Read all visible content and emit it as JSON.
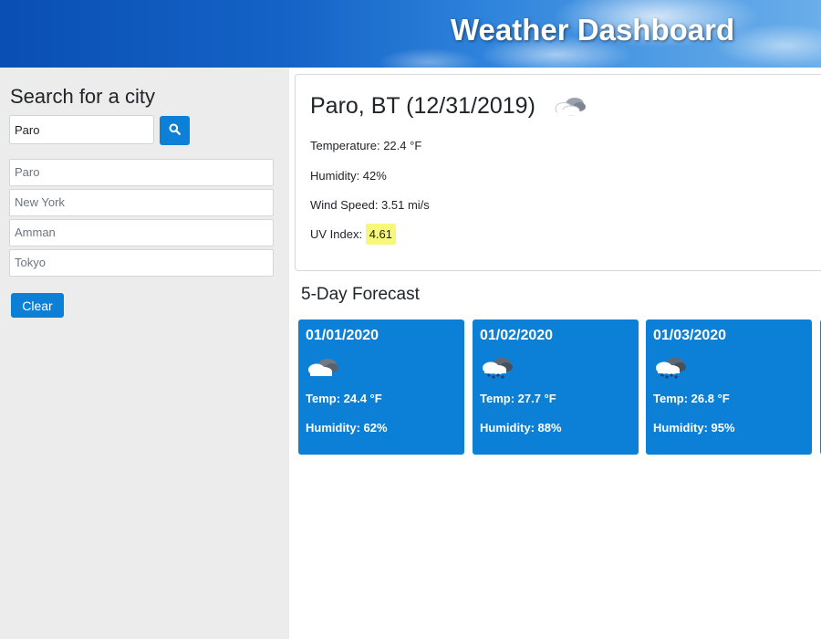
{
  "header": {
    "title": "Weather Dashboard"
  },
  "sidebar": {
    "title": "Search for a city",
    "search_value": "Paro",
    "search_icon": "search-icon",
    "history": [
      "Paro",
      "New York",
      "Amman",
      "Tokyo"
    ],
    "clear_label": "Clear"
  },
  "current": {
    "heading": "Paro, BT (12/31/2019)",
    "icon": "cloud-icon",
    "temperature": "Temperature: 22.4 °F",
    "humidity": "Humidity: 42%",
    "wind": "Wind Speed: 3.51 mi/s",
    "uv_label": "UV Index: ",
    "uv_value": "4.61"
  },
  "forecast": {
    "title": "5-Day Forecast",
    "days": [
      {
        "date": "01/01/2020",
        "icon": "cloud-icon",
        "temp": "Temp: 24.4 °F",
        "humidity": "Humidity: 62%"
      },
      {
        "date": "01/02/2020",
        "icon": "snow-cloud-icon",
        "temp": "Temp: 27.7 °F",
        "humidity": "Humidity: 88%"
      },
      {
        "date": "01/03/2020",
        "icon": "snow-cloud-icon",
        "temp": "Temp: 26.8 °F",
        "humidity": "Humidity: 95%"
      }
    ]
  },
  "colors": {
    "accent": "#0b80d6",
    "sidebar_bg": "#ececec",
    "uv_highlight": "#f7f77a"
  }
}
